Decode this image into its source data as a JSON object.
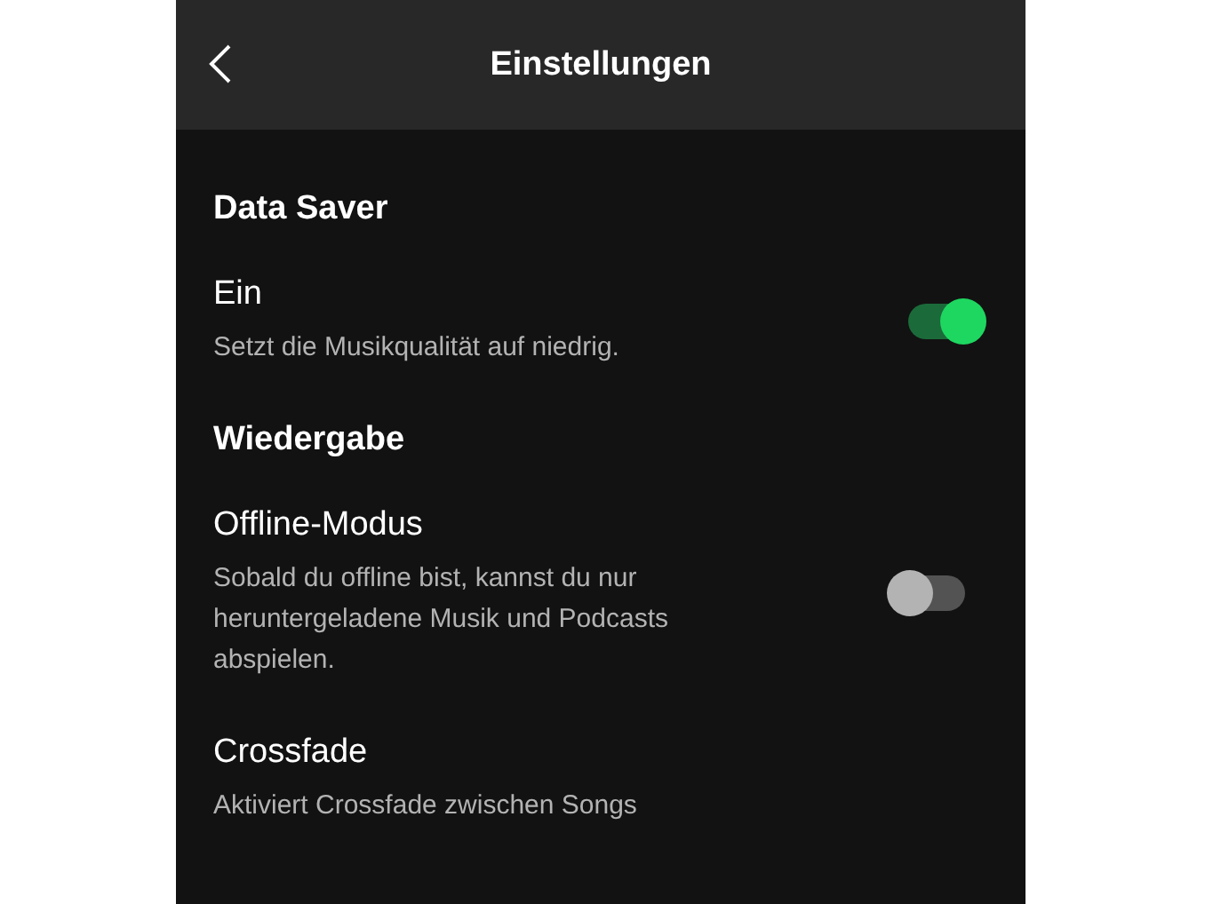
{
  "header": {
    "title": "Einstellungen"
  },
  "sections": [
    {
      "title": "Data Saver",
      "items": [
        {
          "label": "Ein",
          "description": "Setzt die Musikqualität auf niedrig.",
          "kind": "toggle",
          "on": true
        }
      ]
    },
    {
      "title": "Wiedergabe",
      "items": [
        {
          "label": "Offline-Modus",
          "description": "Sobald du offline bist, kannst du nur heruntergeladene Musik und Podcasts abspielen.",
          "kind": "toggle",
          "on": false
        },
        {
          "label": "Crossfade",
          "description": "Aktiviert Crossfade zwischen Songs",
          "kind": "plain"
        }
      ]
    }
  ]
}
